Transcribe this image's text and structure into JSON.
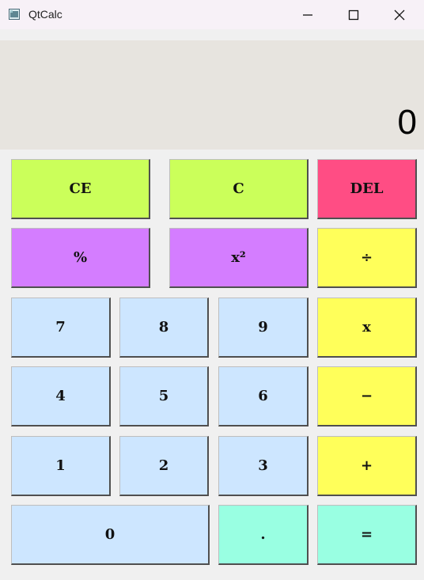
{
  "window": {
    "title": "QtCalc"
  },
  "display": {
    "value": "0"
  },
  "keys": {
    "ce": "CE",
    "c": "C",
    "del": "DEL",
    "percent": "%",
    "square": "x²",
    "divide": "÷",
    "seven": "7",
    "eight": "8",
    "nine": "9",
    "multiply": "x",
    "four": "4",
    "five": "5",
    "six": "6",
    "subtract": "−",
    "one": "1",
    "two": "2",
    "three": "3",
    "add": "+",
    "zero": "0",
    "decimal": ".",
    "equals": "="
  },
  "colors": {
    "clear": "#cbff5a",
    "delete": "#ff4d84",
    "function": "#d47dff",
    "operator": "#ffff5a",
    "digit": "#cde6ff",
    "result": "#99ffe2",
    "display": "#e7e4df"
  },
  "icons": [
    "app-icon",
    "minimize-icon",
    "maximize-icon",
    "close-icon"
  ]
}
